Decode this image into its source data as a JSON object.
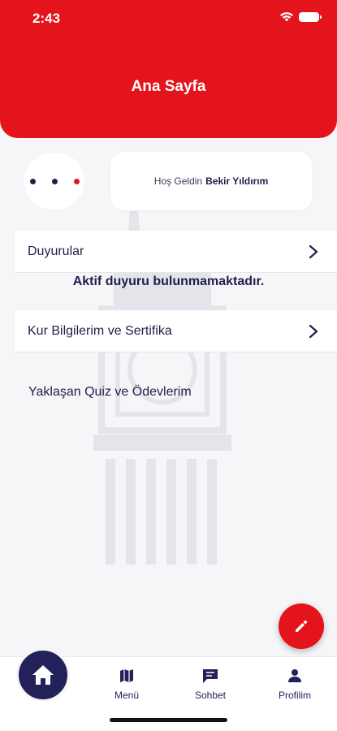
{
  "status_bar": {
    "time": "2:43",
    "icons": [
      "wifi-icon",
      "battery-icon"
    ]
  },
  "header": {
    "title": "Ana Sayfa"
  },
  "welcome": {
    "greeting": "Hoş Geldin",
    "user_name": "Bekir Yıldırım"
  },
  "dots": {
    "colors": [
      "#1e1f4b",
      "#1e1f4b",
      "#e3141b"
    ]
  },
  "sections": {
    "announcements": {
      "label": "Duyurular",
      "empty_message": "Aktif duyuru bulunmamaktadır."
    },
    "courses": {
      "label": "Kur Bilgilerim ve Sertifika"
    },
    "quizzes": {
      "label": "Yaklaşan Quiz ve Ödevlerim"
    }
  },
  "tabbar": {
    "home": {
      "icon": "home-icon"
    },
    "menu": {
      "label": "Menü",
      "icon": "map-icon"
    },
    "chat": {
      "label": "Sohbet",
      "icon": "chat-icon"
    },
    "profile": {
      "label": "Profilim",
      "icon": "person-icon"
    }
  },
  "fab": {
    "icon": "pencil-icon"
  },
  "colors": {
    "primary_red": "#e3141b",
    "navy": "#22215a",
    "background": "#f6f6f8"
  }
}
